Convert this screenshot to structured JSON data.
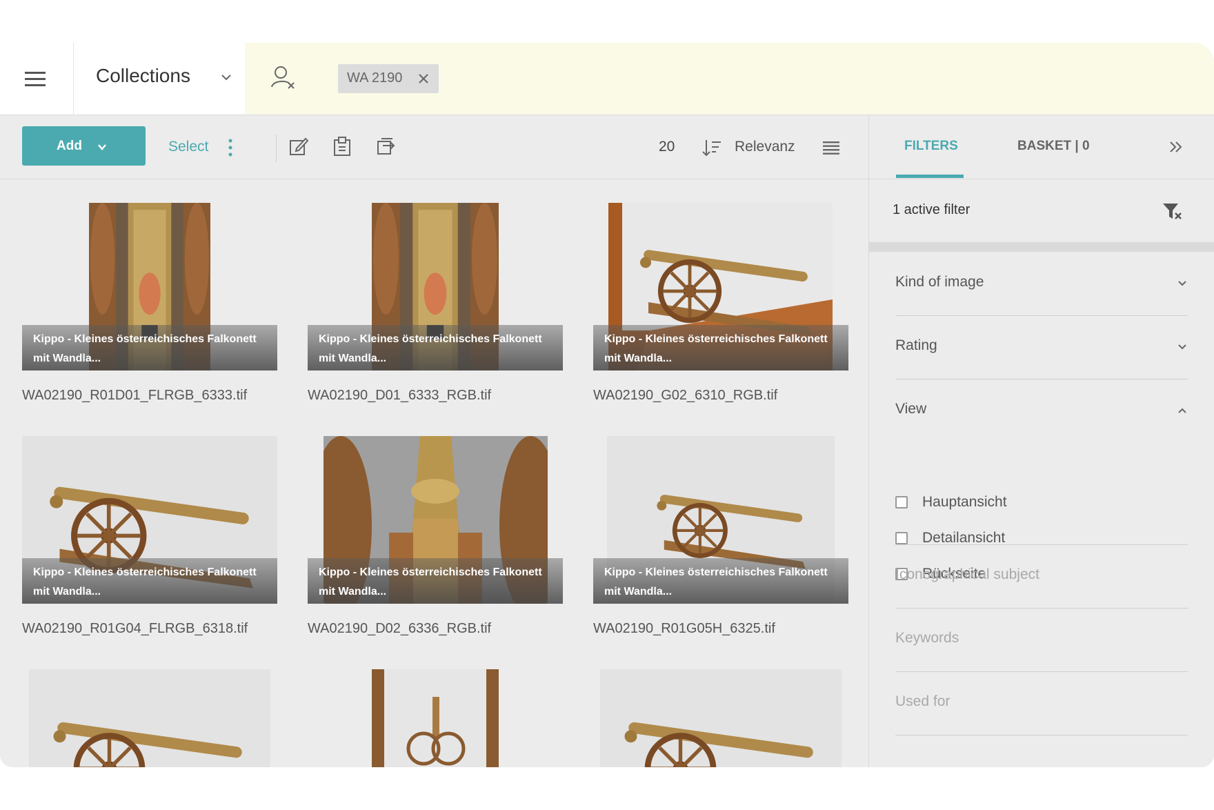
{
  "header": {
    "collections_label": "Collections",
    "filter_chip": "WA 2190"
  },
  "toolbar": {
    "add_label": "Add",
    "select_label": "Select",
    "page_size": "20",
    "sort_label": "Relevanz"
  },
  "grid": {
    "items": [
      {
        "caption": "Kippo - Kleines österreichisches Falkonett mit Wandla...",
        "filename": "WA02190_R01D01_FLRGB_6333.tif"
      },
      {
        "caption": "Kippo - Kleines österreichisches Falkonett mit Wandla...",
        "filename": "WA02190_D01_6333_RGB.tif"
      },
      {
        "caption": "Kippo - Kleines österreichisches Falkonett mit Wandla...",
        "filename": "WA02190_G02_6310_RGB.tif"
      },
      {
        "caption": "Kippo - Kleines österreichisches Falkonett mit Wandla...",
        "filename": "WA02190_R01G04_FLRGB_6318.tif"
      },
      {
        "caption": "Kippo - Kleines österreichisches Falkonett mit Wandla...",
        "filename": "WA02190_D02_6336_RGB.tif"
      },
      {
        "caption": "Kippo - Kleines österreichisches Falkonett mit Wandla...",
        "filename": "WA02190_R01G05H_6325.tif"
      }
    ]
  },
  "panel": {
    "tab_filters": "FILTERS",
    "tab_basket": "BASKET | 0",
    "active_filter_text": "1 active filter",
    "sections": {
      "kind_of_image": "Kind of image",
      "rating": "Rating",
      "view": "View",
      "iconographical_subject": "Iconographical subject",
      "keywords": "Keywords",
      "used_for": "Used for"
    },
    "view_options": [
      "Hauptansicht",
      "Detailansicht",
      "Rückseite"
    ]
  },
  "colors": {
    "accent": "#4aaab0",
    "header_bg": "#fafae6",
    "canvas_bg": "#ececec"
  },
  "icons": [
    "menu-icon",
    "chevron-down-icon",
    "user-remove-icon",
    "close-icon",
    "more-vertical-icon",
    "edit-icon",
    "clipboard-icon",
    "export-icon",
    "sort-icon",
    "list-view-icon",
    "double-chevron-right-icon",
    "clear-filter-icon",
    "chevron-up-icon"
  ]
}
